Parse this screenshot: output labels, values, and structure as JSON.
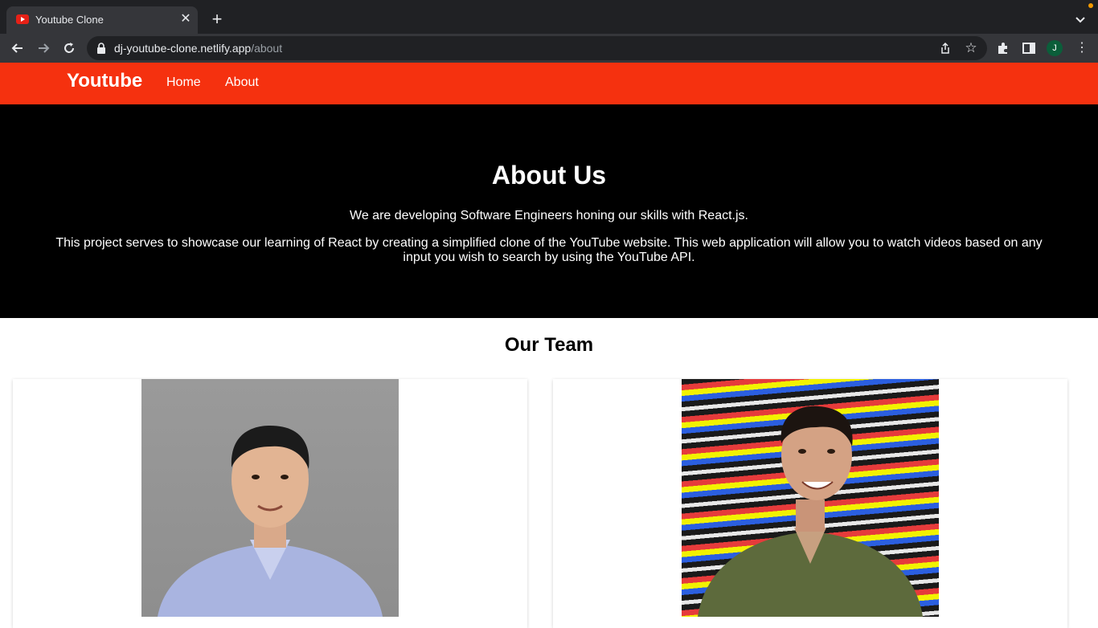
{
  "browser": {
    "tab_title": "Youtube Clone",
    "url_domain": "dj-youtube-clone.netlify.app",
    "url_path": "/about",
    "profile_initial": "J"
  },
  "site": {
    "brand": "Youtube",
    "nav": [
      "Home",
      "About"
    ],
    "hero": {
      "title": "About Us",
      "line1": "We are developing Software Engineers honing our skills with React.js.",
      "line2": "This project serves to showcase our learning of React by creating a simplified clone of the YouTube website. This web application will allow you to watch videos based on any input you wish to search by using the YouTube API."
    },
    "team_title": "Our Team"
  },
  "colors": {
    "navbar": "#f5310f",
    "hero_bg": "#000000"
  }
}
